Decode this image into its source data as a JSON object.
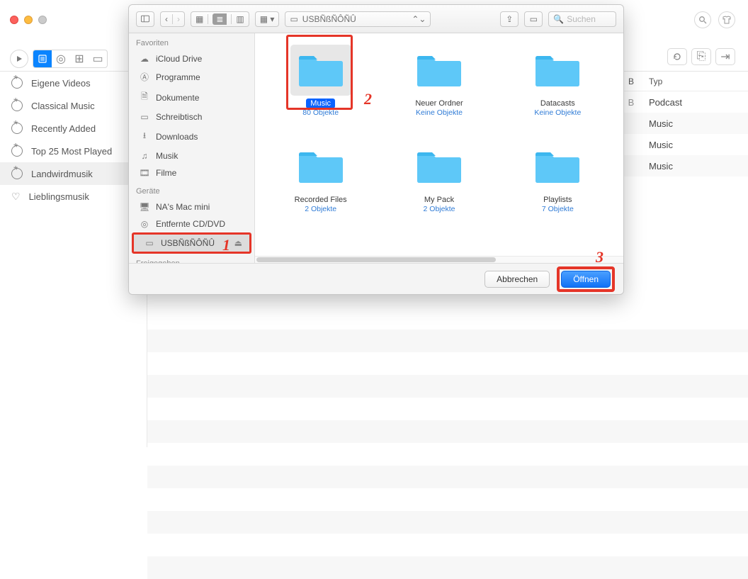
{
  "finder": {
    "path_name": "USBÑßÑÔÑÛ",
    "search_placeholder": "Suchen",
    "sidebar": {
      "favorites_header": "Favoriten",
      "devices_header": "Geräte",
      "shared_header": "Freigegeben",
      "favorites": [
        {
          "label": "iCloud Drive",
          "icon": "cloud"
        },
        {
          "label": "Programme",
          "icon": "app"
        },
        {
          "label": "Dokumente",
          "icon": "doc"
        },
        {
          "label": "Schreibtisch",
          "icon": "desk"
        },
        {
          "label": "Downloads",
          "icon": "down"
        },
        {
          "label": "Musik",
          "icon": "music"
        },
        {
          "label": "Filme",
          "icon": "film"
        }
      ],
      "devices": [
        {
          "label": "NA's Mac mini",
          "icon": "host"
        },
        {
          "label": "Entfernte CD/DVD",
          "icon": "disc"
        },
        {
          "label": "USBÑßÑÔÑÛ",
          "icon": "drive",
          "selected": true,
          "eject": true
        }
      ]
    },
    "grid": [
      {
        "name": "Music",
        "sub": "80 Objekte",
        "selected": true
      },
      {
        "name": "Neuer Ordner",
        "sub": "Keine Objekte"
      },
      {
        "name": "Datacasts",
        "sub": "Keine Objekte"
      },
      {
        "name": "Recorded Files",
        "sub": "2 Objekte"
      },
      {
        "name": "My Pack",
        "sub": "2 Objekte"
      },
      {
        "name": "Playlists",
        "sub": "7 Objekte"
      }
    ],
    "footer": {
      "cancel": "Abbrechen",
      "open": "Öffnen"
    },
    "annotations": {
      "a1": "1",
      "a2": "2",
      "a3": "3"
    }
  },
  "bg": {
    "playlists": [
      {
        "label": "Eigene Videos"
      },
      {
        "label": "Classical Music"
      },
      {
        "label": "Recently Added"
      },
      {
        "label": "Top 25 Most Played"
      },
      {
        "label": "Landwirdmusik",
        "selected": true
      },
      {
        "label": "Lieblingsmusik",
        "heart": true
      }
    ],
    "col_b": "B",
    "col_typ": "Typ",
    "rows": [
      {
        "b": "B",
        "typ": "Podcast"
      },
      {
        "b": "",
        "typ": "Music"
      },
      {
        "b": "",
        "typ": "Music"
      },
      {
        "b": "",
        "typ": "Music"
      }
    ]
  }
}
